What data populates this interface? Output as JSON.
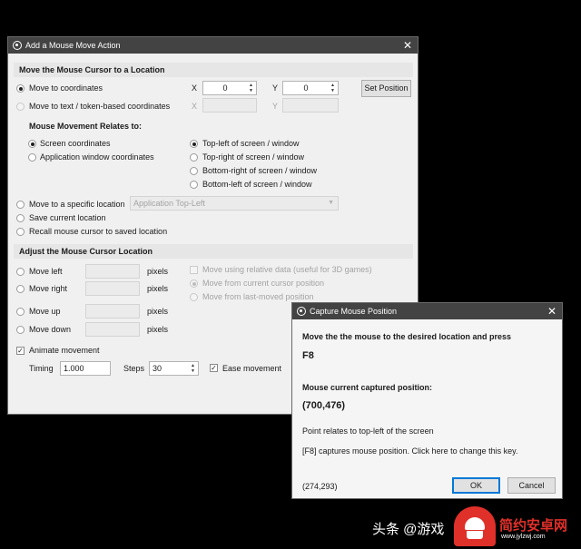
{
  "main_dialog": {
    "title": "Add a Mouse Move Action",
    "section_move": "Move the Mouse Cursor to a Location",
    "move_to_coordinates": "Move to coordinates",
    "move_to_text": "Move to text / token-based coordinates",
    "x_label": "X",
    "y_label": "Y",
    "x_value": "0",
    "y_value": "0",
    "set_position": "Set Position",
    "relates_heading": "Mouse Movement Relates to:",
    "screen_coordinates": "Screen coordinates",
    "app_window_coordinates": "Application window coordinates",
    "top_left": "Top-left of screen / window",
    "top_right": "Top-right of screen / window",
    "bottom_right": "Bottom-right of screen / window",
    "bottom_left": "Bottom-left of screen / window",
    "move_specific": "Move to a specific location",
    "specific_dropdown": "Application Top-Left",
    "save_location": "Save current location",
    "recall_location": "Recall mouse cursor to saved location",
    "section_adjust": "Adjust the Mouse Cursor Location",
    "move_left": "Move left",
    "move_right": "Move right",
    "move_up": "Move up",
    "move_down": "Move down",
    "pixels": "pixels",
    "relative_data": "Move using relative data (useful for 3D games)",
    "from_current": "Move from current cursor position",
    "from_last": "Move from last-moved position",
    "animate": "Animate movement",
    "timing_label": "Timing",
    "timing_value": "1.000",
    "steps_label": "Steps",
    "steps_value": "30",
    "ease": "Ease movement"
  },
  "capture_dialog": {
    "title": "Capture Mouse Position",
    "instruction": "Move the the mouse to the desired location and press",
    "key": "F8",
    "captured_label": "Mouse current captured position:",
    "captured_value": "(700,476)",
    "relates_note": "Point relates to top-left of the screen",
    "hotkey_note": "[F8] captures mouse position.  Click here to change this key.",
    "live_position": "(274,293)",
    "ok": "OK",
    "cancel": "Cancel"
  },
  "watermark": {
    "prefix": "头条 @游戏",
    "brand": "简约安卓网",
    "url": "www.jylzwj.com"
  },
  "colors": {
    "titlebar": "#434343",
    "dialog_bg": "#f0f0f0",
    "section_bg": "#e6e6e6",
    "accent": "#0078d7",
    "logo_red": "#e0302a"
  }
}
